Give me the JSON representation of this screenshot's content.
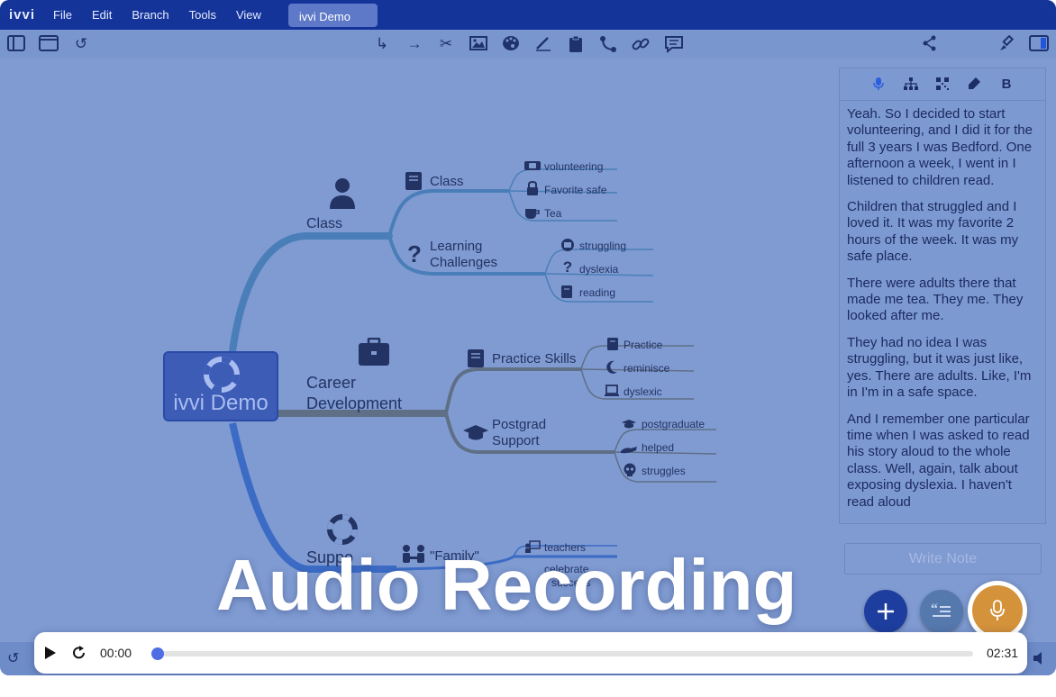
{
  "menubar": {
    "logo": "ivvi",
    "items": [
      "File",
      "Edit",
      "Branch",
      "Tools",
      "View"
    ],
    "doc_tab": "ivvi Demo"
  },
  "toolbar": {
    "left_icons": [
      "sidebar-icon",
      "window-icon",
      "undo-icon"
    ],
    "center_icons": [
      "branch-arrow-icon",
      "arrow-right-icon",
      "scissors-icon",
      "image-icon",
      "palette-icon",
      "pen-icon",
      "clipboard-icon",
      "connector-icon",
      "link-icon",
      "comment-icon"
    ],
    "right_icons": [
      "share-icon",
      "brush-icon",
      "panel-icon"
    ]
  },
  "mindmap": {
    "root": "ivvi Demo",
    "branches": {
      "class": {
        "label": "Class",
        "children": {
          "class": {
            "label": "Class",
            "leaves": [
              "volunteering",
              "Favorite safe",
              "Tea"
            ]
          },
          "learning": {
            "line1": "Learning",
            "line2": "Challenges",
            "leaves": [
              "struggling",
              "dyslexia",
              "reading"
            ]
          }
        }
      },
      "career": {
        "line1": "Career",
        "line2": "Development",
        "children": {
          "practice": {
            "label": "Practice Skills",
            "leaves": [
              "Practice",
              "reminisce",
              "dyslexic"
            ]
          },
          "postgrad": {
            "line1": "Postgrad",
            "line2": "Support",
            "leaves": [
              "postgraduate",
              "helped",
              "struggles"
            ]
          }
        }
      },
      "support": {
        "label": "Suppo",
        "children": {
          "family": {
            "label": "\"Family\"",
            "leaves": [
              "teachers",
              "celebrate",
              "success"
            ]
          }
        }
      }
    }
  },
  "notes": {
    "toolbar_icons": [
      "microphone-icon",
      "hierarchy-icon",
      "qr-icon",
      "highlighter-icon",
      "bold-icon"
    ],
    "bold_label": "B",
    "paragraphs": [
      "Yeah. So I decided to start volunteering, and I did it for the full 3 years I was Bedford. One afternoon a week, I went in I listened to children read.",
      "Children that struggled and I loved it. It was my favorite 2 hours of the week. It was my safe place.",
      "There were adults there that made me tea. They me. They looked after me.",
      "They had no idea I was struggling, but it was just like, yes. There are adults. Like, I'm in I'm in a safe space.",
      "And I remember one particular time when I was asked to read his story aloud to the whole class. Well, again, talk about exposing dyslexia. I haven't read aloud"
    ],
    "write_note_placeholder": "Write Note"
  },
  "overlay": {
    "title": "Audio Recording"
  },
  "player": {
    "current_time": "00:00",
    "duration": "02:31",
    "progress": 0.0
  },
  "colors": {
    "menubar": "#15349a",
    "canvas": "#7f9bd2",
    "fab_add": "#1d3e9e",
    "fab_notes": "#5578ad",
    "fab_mic": "#d4923a",
    "progress_knob": "#4f6ee6"
  }
}
